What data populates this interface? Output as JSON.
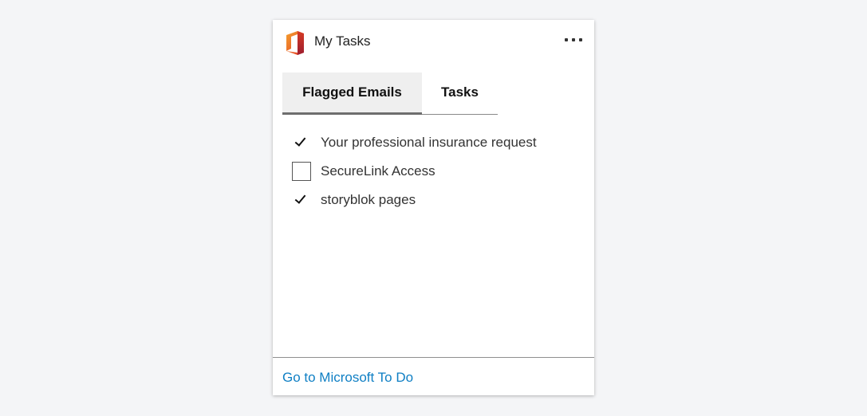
{
  "header": {
    "title": "My Tasks",
    "logo_icon": "office-logo-icon",
    "menu_icon": "more-options-icon"
  },
  "tabs": [
    {
      "label": "Flagged Emails",
      "active": true
    },
    {
      "label": "Tasks",
      "active": false
    }
  ],
  "items": [
    {
      "label": "Your professional insurance request",
      "checked": true
    },
    {
      "label": "SecureLink Access",
      "checked": false
    },
    {
      "label": "storyblok pages",
      "checked": true
    }
  ],
  "footer": {
    "link_label": "Go to Microsoft To Do"
  },
  "colors": {
    "background": "#f4f5f7",
    "card": "#ffffff",
    "link": "#0f7fc4",
    "active_tab_bg": "#efefef",
    "logo_orange": "#e8551f",
    "logo_red": "#b7292b"
  }
}
